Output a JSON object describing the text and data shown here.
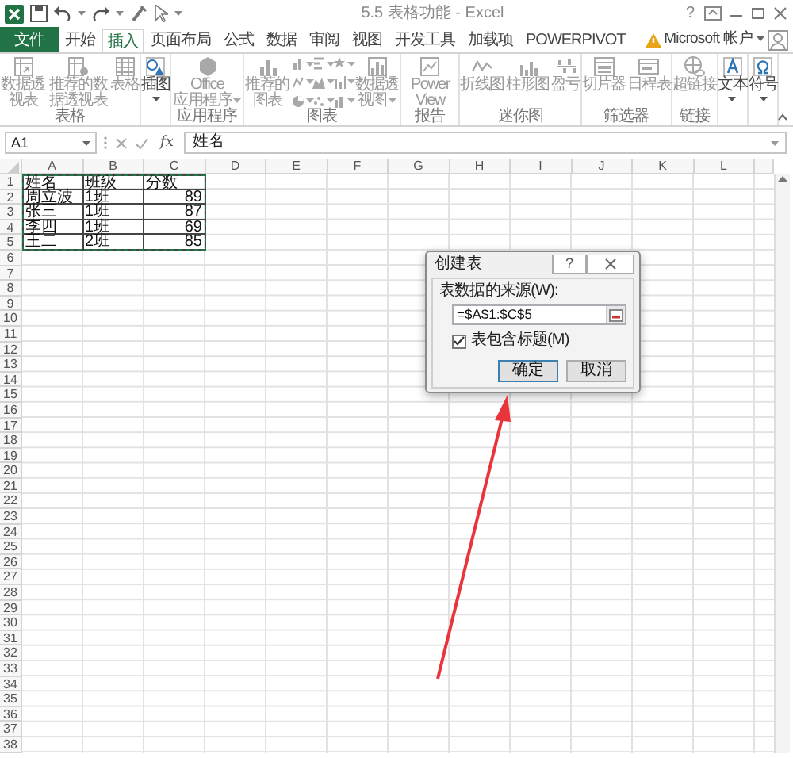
{
  "window": {
    "title": "5.5 表格功能 - Excel",
    "help": "?"
  },
  "tabs": [
    {
      "label": "文件",
      "kind": "file",
      "selected": false
    },
    {
      "label": "开始",
      "kind": "tab",
      "selected": false
    },
    {
      "label": "插入",
      "kind": "tab",
      "selected": true
    },
    {
      "label": "页面布局",
      "kind": "tab",
      "selected": false
    },
    {
      "label": "公式",
      "kind": "tab",
      "selected": false
    },
    {
      "label": "数据",
      "kind": "tab",
      "selected": false
    },
    {
      "label": "审阅",
      "kind": "tab",
      "selected": false
    },
    {
      "label": "视图",
      "kind": "tab",
      "selected": false
    },
    {
      "label": "开发工具",
      "kind": "tab",
      "selected": false
    },
    {
      "label": "加载项",
      "kind": "tab",
      "selected": false
    },
    {
      "label": "POWERPIVOT",
      "kind": "tab",
      "selected": false
    }
  ],
  "account": {
    "label": "Microsoft 帐户"
  },
  "ribbon": {
    "groups": [
      {
        "label": "表格",
        "buttons": [
          {
            "kind": "large",
            "label": "数据透视表",
            "dropdown": false,
            "disabled": true
          },
          {
            "kind": "large",
            "label": "推荐的数据透视表",
            "dropdown": false,
            "disabled": true
          },
          {
            "kind": "large",
            "label": "表格",
            "dropdown": false,
            "disabled": true
          }
        ]
      },
      {
        "buttons": [
          {
            "kind": "large",
            "label": "插图",
            "dropdown": true,
            "disabled": false
          }
        ]
      },
      {
        "label": "应用程序",
        "buttons": [
          {
            "kind": "large",
            "label": "Office 应用程序",
            "dropdown": true,
            "disabled": true
          }
        ]
      },
      {
        "label": "图表",
        "buttons": [
          {
            "kind": "large",
            "label": "推荐的图表",
            "dropdown": false,
            "disabled": true
          },
          {
            "kind": "grid",
            "disabled": true
          },
          {
            "kind": "large",
            "label": "数据透视图",
            "dropdown": true,
            "disabled": true
          }
        ]
      },
      {
        "label": "报告",
        "buttons": [
          {
            "kind": "large",
            "label": "Power View",
            "dropdown": false,
            "disabled": true
          }
        ]
      },
      {
        "label": "迷你图",
        "buttons": [
          {
            "kind": "large",
            "label": "折线图",
            "dropdown": false,
            "disabled": true
          },
          {
            "kind": "large",
            "label": "柱形图",
            "dropdown": false,
            "disabled": true
          },
          {
            "kind": "large",
            "label": "盈亏",
            "dropdown": false,
            "disabled": true
          }
        ]
      },
      {
        "label": "筛选器",
        "buttons": [
          {
            "kind": "large",
            "label": "切片器",
            "dropdown": false,
            "disabled": true
          },
          {
            "kind": "large",
            "label": "日程表",
            "dropdown": false,
            "disabled": true
          }
        ]
      },
      {
        "label": "链接",
        "buttons": [
          {
            "kind": "large",
            "label": "超链接",
            "dropdown": false,
            "disabled": true
          }
        ]
      },
      {
        "buttons": [
          {
            "kind": "large",
            "label": "文本",
            "dropdown": true,
            "disabled": false
          }
        ]
      },
      {
        "buttons": [
          {
            "kind": "large",
            "label": "符号",
            "dropdown": true,
            "disabled": false
          }
        ]
      }
    ]
  },
  "name_box": "A1",
  "formula_bar": {
    "function": "fx",
    "value": "姓名"
  },
  "sheet": {
    "columns": [
      "A",
      "B",
      "C",
      "D",
      "E",
      "F",
      "G",
      "H",
      "I",
      "J",
      "K",
      "L"
    ],
    "rows": [
      "1",
      "2",
      "3",
      "4",
      "5",
      "6",
      "7",
      "8",
      "9",
      "10",
      "11",
      "12",
      "13",
      "14",
      "15",
      "16",
      "17",
      "18",
      "19",
      "20",
      "21",
      "22",
      "23",
      "24",
      "25",
      "26",
      "27",
      "28",
      "29",
      "30",
      "31",
      "32",
      "33",
      "34",
      "35",
      "36",
      "37",
      "38"
    ],
    "cells": [
      [
        "姓名",
        "班级",
        "分数"
      ],
      [
        "周立波",
        "1班",
        "89"
      ],
      [
        "张三",
        "1班",
        "87"
      ],
      [
        "李四",
        "1班",
        "69"
      ],
      [
        "王二",
        "2班",
        "85"
      ]
    ],
    "marquee": true
  },
  "dialog": {
    "title": "创建表",
    "help": "?",
    "source_label": "表数据的来源(W):",
    "source_value": "=$A$1:$C$5",
    "has_headers": {
      "label": "表包含标题(M)",
      "checked": true
    },
    "buttons": [
      {
        "label": "确定",
        "default": true
      },
      {
        "label": "取消",
        "default": false
      }
    ]
  }
}
